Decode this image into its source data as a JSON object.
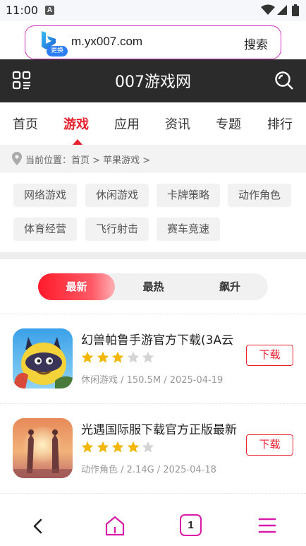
{
  "status_bar": {
    "time": "11:00",
    "notification_icon": "A"
  },
  "address_bar": {
    "badge": "更换",
    "url": "m.yx007.com",
    "search_label": "搜索"
  },
  "site_header": {
    "title": "007游戏网"
  },
  "category_nav": {
    "tabs": [
      "首页",
      "游戏",
      "应用",
      "资讯",
      "专题",
      "排行"
    ],
    "active_index": 1
  },
  "breadcrumb": {
    "prefix": "当前位置：",
    "path": "首页 > 苹果游戏 >"
  },
  "subcategories": [
    "网络游戏",
    "休闲游戏",
    "卡牌策略",
    "动作角色",
    "体育经营",
    "飞行射击",
    "赛车竞速"
  ],
  "sort_tabs": [
    "最新",
    "最热",
    "飙升"
  ],
  "sort_active": "最新",
  "games": [
    {
      "name": "幻兽帕鲁手游官方下载(3A云",
      "rating": 3,
      "max_rating": 5,
      "meta": "休闲游戏 / 150.5M / 2025-04-19",
      "download_label": "下载",
      "icon": "palworld-game-icon"
    },
    {
      "name": "光遇国际服下载官方正版最新",
      "rating": 4,
      "max_rating": 5,
      "meta": "动作角色 / 2.14G / 2025-04-18",
      "download_label": "下载",
      "icon": "sky-game-icon"
    }
  ],
  "bottom_nav": {
    "tab_count": "1"
  },
  "colors": {
    "accent_red": "#e8212f",
    "header_bg": "#2b2b2b",
    "browser_accent": "#d81ba8",
    "star_gold": "#f2b705",
    "star_empty": "#d4d4d4"
  }
}
